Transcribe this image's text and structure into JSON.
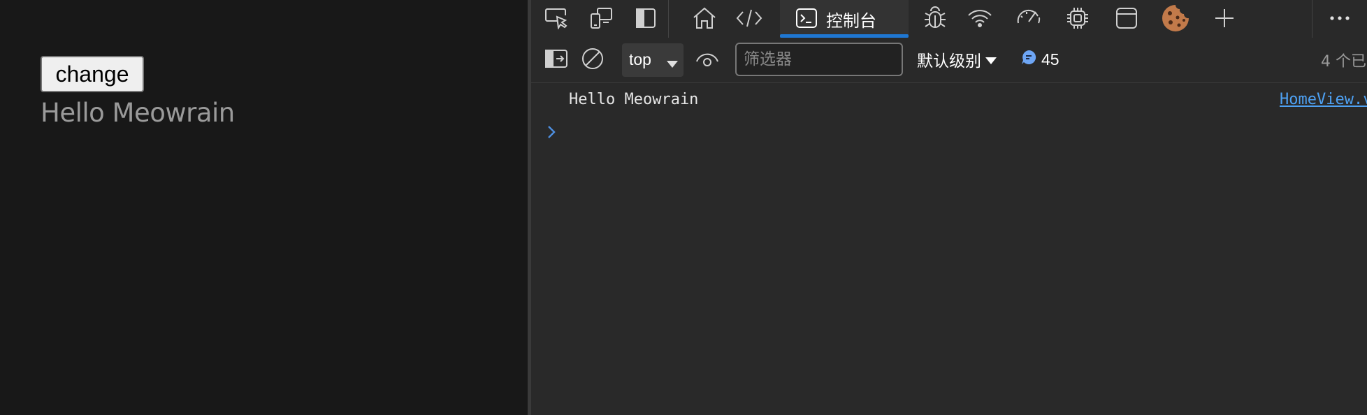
{
  "page": {
    "button_label": "change",
    "greeting": "Hello Meowrain"
  },
  "devtools": {
    "tabs": {
      "console_label": "控制台",
      "icons": [
        "inspect-icon",
        "device-emulation-icon",
        "dock-panel-icon",
        "home-icon",
        "elements-icon",
        "console-icon",
        "bug-icon",
        "network-wifi-icon",
        "performance-gauge-icon",
        "cpu-icon",
        "application-window-icon",
        "cookie-icon",
        "plus-icon",
        "more-icon"
      ]
    },
    "toolbar": {
      "context_value": "top",
      "filter_placeholder": "筛选器",
      "level_label": "默认级别",
      "message_count": "45",
      "hidden_count": "4 个已"
    },
    "console": {
      "log_text": "Hello Meowrain",
      "log_source": "HomeView.v"
    },
    "colors": {
      "accent": "#1f77d2",
      "link": "#4ea1f3",
      "background": "#292929"
    }
  }
}
